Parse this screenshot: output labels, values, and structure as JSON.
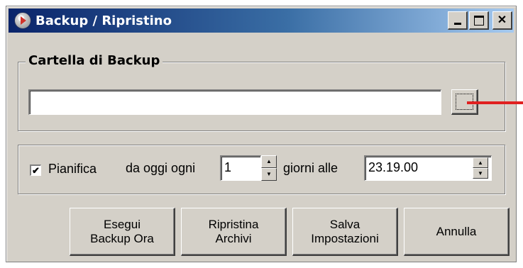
{
  "window": {
    "title": "Backup / Ripristino",
    "icon": "backup-app-icon",
    "controls": [
      "minimize-icon",
      "maximize-icon",
      "close-icon"
    ]
  },
  "backup_folder": {
    "legend": "Cartella di Backup",
    "path_value": "",
    "browse_label": ""
  },
  "schedule": {
    "checkbox_checked": true,
    "checkbox_mark": "✔",
    "checkbox_label": "Pianifica",
    "from_today_label": "da oggi ogni",
    "days_value": "1",
    "days_label": "giorni alle",
    "time_value": "23.19.00"
  },
  "spin_glyphs": {
    "up": "▲",
    "down": "▼"
  },
  "buttons": [
    {
      "line1": "Esegui",
      "line2": "Backup Ora"
    },
    {
      "line1": "Ripristina",
      "line2": "Archivi"
    },
    {
      "line1": "Salva",
      "line2": "Impostazioni"
    },
    {
      "line1": "Annulla",
      "line2": ""
    }
  ],
  "colors": {
    "titlebar_start": "#0a246a",
    "titlebar_end": "#a6caf0",
    "face": "#d4d0c8",
    "annotation_arrow": "#e02020"
  }
}
